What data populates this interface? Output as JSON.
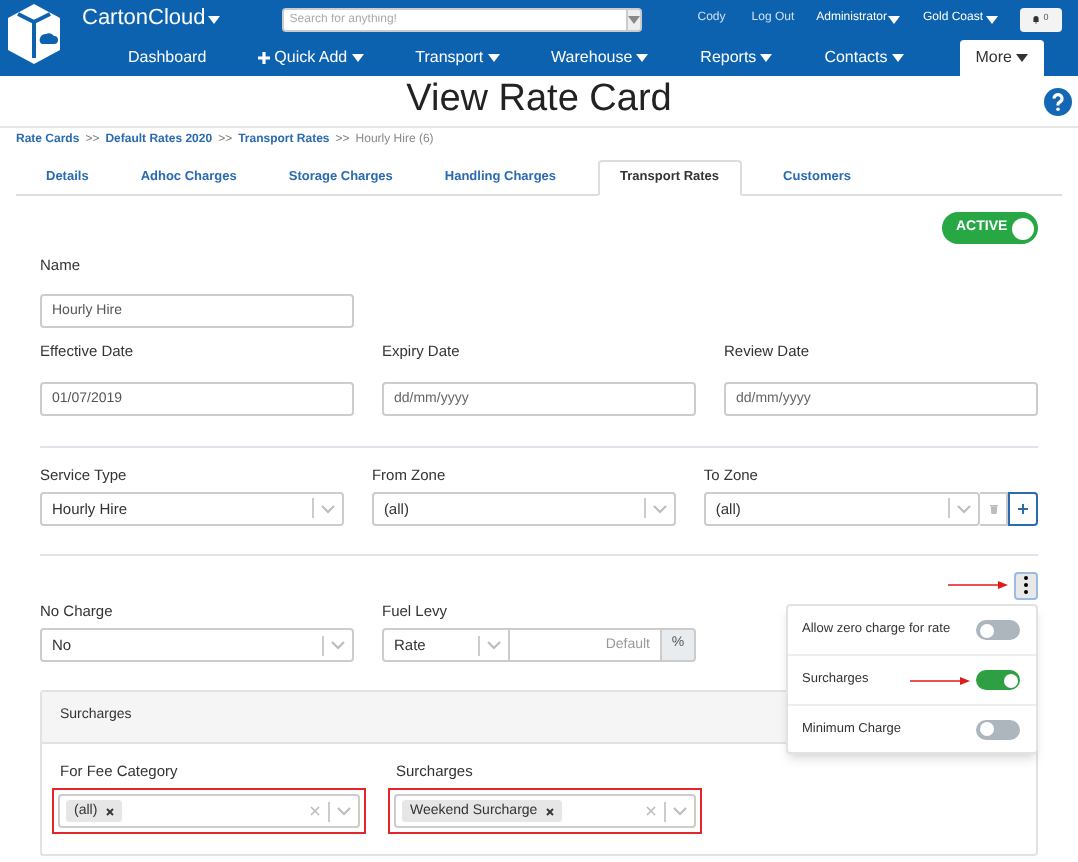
{
  "app": {
    "brand": "CartonCloud",
    "search_placeholder": "Search for anything!",
    "user_links": [
      "Cody",
      "Log Out"
    ],
    "menus": [
      "Administrator",
      "Gold Coast"
    ],
    "notifications": "0"
  },
  "nav": [
    {
      "label": "Dashboard",
      "dropdown": false,
      "kind": "link",
      "selected": false
    },
    {
      "label": "Quick Add",
      "dropdown": true,
      "kind": "add",
      "selected": false
    },
    {
      "label": "Transport",
      "dropdown": true,
      "kind": "link",
      "selected": false
    },
    {
      "label": "Warehouse",
      "dropdown": true,
      "kind": "link",
      "selected": false
    },
    {
      "label": "Reports",
      "dropdown": true,
      "kind": "link",
      "selected": false
    },
    {
      "label": "Contacts",
      "dropdown": true,
      "kind": "link",
      "selected": false
    },
    {
      "label": "More",
      "dropdown": true,
      "kind": "link",
      "selected": true
    }
  ],
  "page_title": "View Rate Card",
  "breadcrumb": [
    {
      "label": "Rate Cards",
      "link": true
    },
    {
      "label": "Default Rates 2020",
      "link": true
    },
    {
      "label": "Transport Rates",
      "link": true
    },
    {
      "label": "Hourly Hire (6)",
      "link": false
    }
  ],
  "breadcrumb_separator": ">>",
  "tabs": [
    {
      "label": "Details",
      "selected": false
    },
    {
      "label": "Adhoc Charges",
      "selected": false
    },
    {
      "label": "Storage Charges",
      "selected": false
    },
    {
      "label": "Handling Charges",
      "selected": false
    },
    {
      "label": "Transport Rates",
      "selected": true
    },
    {
      "label": "Customers",
      "selected": false
    }
  ],
  "status_toggle": {
    "label": "ACTIVE",
    "on": true
  },
  "name_field": {
    "label": "Name",
    "value": "Hourly Hire"
  },
  "date_fields": [
    {
      "label": "Effective Date",
      "value": "01/07/2019"
    },
    {
      "label": "Expiry Date",
      "placeholder": "dd/mm/yyyy"
    },
    {
      "label": "Review Date",
      "placeholder": "dd/mm/yyyy"
    }
  ],
  "zone_fields": [
    {
      "label": "Service Type",
      "value": "Hourly Hire",
      "actions": false
    },
    {
      "label": "From Zone",
      "value": "(all)",
      "actions": false
    },
    {
      "label": "To Zone",
      "value": "(all)",
      "actions": true
    }
  ],
  "no_charge": {
    "label": "No Charge",
    "value": "No"
  },
  "fuel_levy": {
    "label": "Fuel Levy",
    "type": "Rate",
    "placeholder": "Default",
    "unit": "%"
  },
  "options_menu": {
    "open": true,
    "annotated": true,
    "items": [
      {
        "label": "Allow zero charge for rate",
        "on": false,
        "annotated": false
      },
      {
        "label": "Surcharges",
        "on": true,
        "annotated": true
      },
      {
        "label": "Minimum Charge",
        "on": false,
        "annotated": false
      }
    ]
  },
  "surcharges_panel": {
    "title": "Surcharges",
    "fields": [
      {
        "label": "For Fee Category",
        "tags": [
          "(all)"
        ],
        "highlighted": true
      },
      {
        "label": "Surcharges",
        "tags": [
          "Weekend Surcharge"
        ],
        "highlighted": true
      }
    ]
  }
}
